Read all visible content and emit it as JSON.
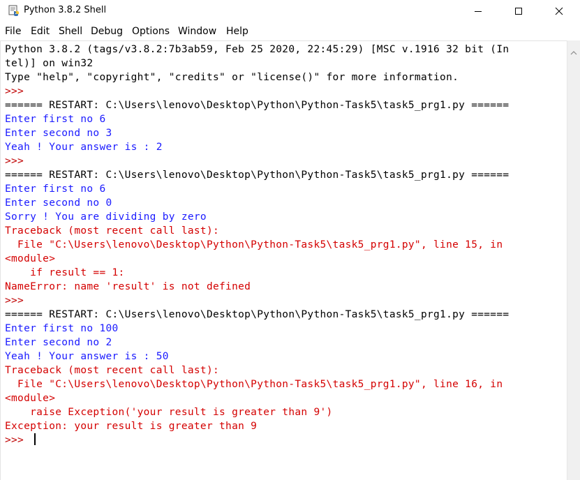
{
  "window": {
    "title": "Python 3.8.2 Shell",
    "icons": {
      "app": "python-idle-icon",
      "minimize": "minimize-icon",
      "maximize": "maximize-icon",
      "close": "close-icon"
    }
  },
  "menu": {
    "items": [
      "File",
      "Edit",
      "Shell",
      "Debug",
      "Options",
      "Window",
      "Help"
    ]
  },
  "colors": {
    "stdout": "#000000",
    "prompt": "#c00000",
    "user_output": "#1a1aff",
    "error": "#d40000"
  },
  "shell": {
    "lines": [
      {
        "text": "Python 3.8.2 (tags/v3.8.2:7b3ab59, Feb 25 2020, 22:45:29) [MSC v.1916 32 bit (In",
        "kind": "stdout"
      },
      {
        "text": "tel)] on win32",
        "kind": "stdout"
      },
      {
        "text": "Type \"help\", \"copyright\", \"credits\" or \"license()\" for more information.",
        "kind": "stdout"
      },
      {
        "text": ">>> ",
        "kind": "prompt"
      },
      {
        "text": "====== RESTART: C:\\Users\\lenovo\\Desktop\\Python\\Python-Task5\\task5_prg1.py ======",
        "kind": "restart"
      },
      {
        "text": "Enter first no 6",
        "kind": "blue"
      },
      {
        "text": "Enter second no 3",
        "kind": "blue"
      },
      {
        "text": "Yeah ! Your answer is : 2",
        "kind": "blue"
      },
      {
        "text": ">>> ",
        "kind": "prompt"
      },
      {
        "text": "====== RESTART: C:\\Users\\lenovo\\Desktop\\Python\\Python-Task5\\task5_prg1.py ======",
        "kind": "restart"
      },
      {
        "text": "Enter first no 6",
        "kind": "blue"
      },
      {
        "text": "Enter second no 0",
        "kind": "blue"
      },
      {
        "text": "Sorry ! You are dividing by zero",
        "kind": "blue"
      },
      {
        "text": "Traceback (most recent call last):",
        "kind": "red"
      },
      {
        "text": "  File \"C:\\Users\\lenovo\\Desktop\\Python\\Python-Task5\\task5_prg1.py\", line 15, in",
        "kind": "red"
      },
      {
        "text": "<module>",
        "kind": "red"
      },
      {
        "text": "    if result == 1:",
        "kind": "red"
      },
      {
        "text": "NameError: name 'result' is not defined",
        "kind": "red"
      },
      {
        "text": ">>> ",
        "kind": "prompt"
      },
      {
        "text": "====== RESTART: C:\\Users\\lenovo\\Desktop\\Python\\Python-Task5\\task5_prg1.py ======",
        "kind": "restart"
      },
      {
        "text": "Enter first no 100",
        "kind": "blue"
      },
      {
        "text": "Enter second no 2",
        "kind": "blue"
      },
      {
        "text": "Yeah ! Your answer is : 50",
        "kind": "blue"
      },
      {
        "text": "Traceback (most recent call last):",
        "kind": "red"
      },
      {
        "text": "  File \"C:\\Users\\lenovo\\Desktop\\Python\\Python-Task5\\task5_prg1.py\", line 16, in",
        "kind": "red"
      },
      {
        "text": "<module>",
        "kind": "red"
      },
      {
        "text": "    raise Exception('your result is greater than 9')",
        "kind": "red"
      },
      {
        "text": "Exception: your result is greater than 9",
        "kind": "red"
      }
    ],
    "current_prompt": ">>> "
  }
}
